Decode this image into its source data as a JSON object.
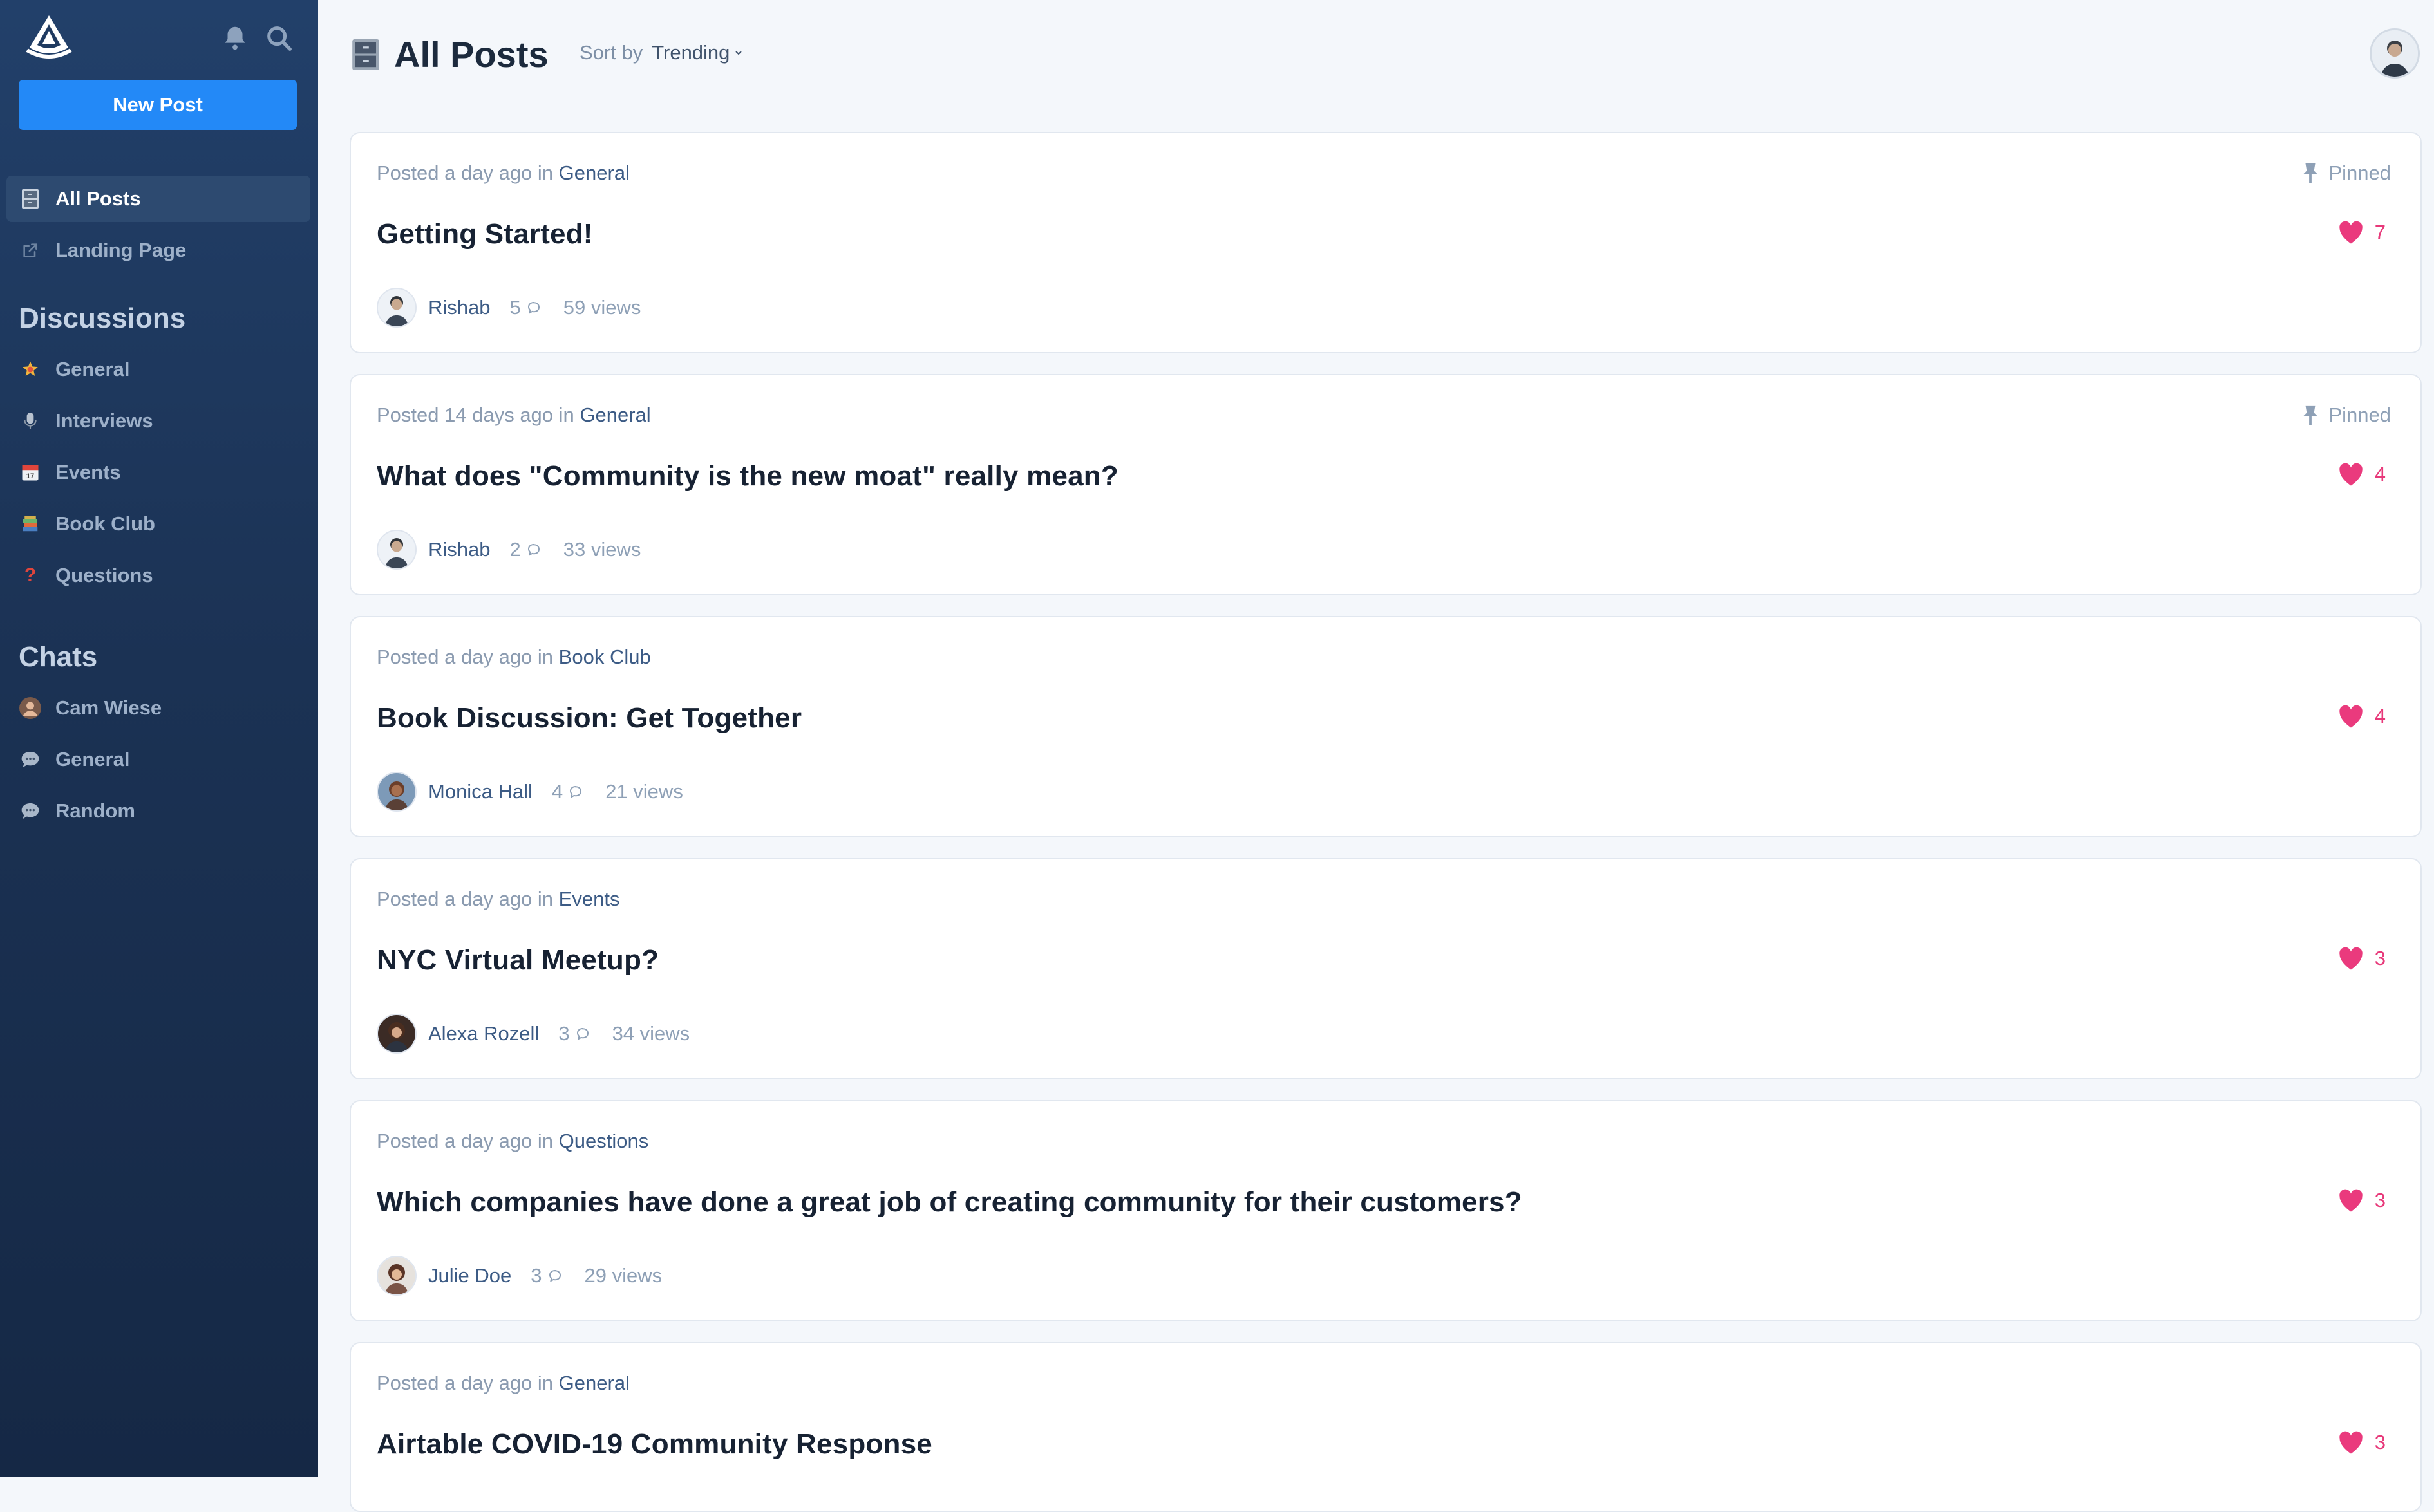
{
  "sidebar": {
    "new_post_label": "New Post",
    "nav": [
      {
        "label": "All Posts",
        "icon": "file-cabinet-icon",
        "active": true
      },
      {
        "label": "Landing Page",
        "icon": "external-link-icon",
        "active": false
      }
    ],
    "discussions_heading": "Discussions",
    "discussions": [
      {
        "label": "General",
        "icon": "star-emoji-icon"
      },
      {
        "label": "Interviews",
        "icon": "microphone-emoji-icon"
      },
      {
        "label": "Events",
        "icon": "calendar-emoji-icon"
      },
      {
        "label": "Book Club",
        "icon": "books-emoji-icon"
      },
      {
        "label": "Questions",
        "icon": "question-mark-emoji-icon"
      }
    ],
    "chats_heading": "Chats",
    "chats": [
      {
        "label": "Cam Wiese",
        "icon": "avatar"
      },
      {
        "label": "General",
        "icon": "speech-bubble-emoji-icon"
      },
      {
        "label": "Random",
        "icon": "speech-bubble-emoji-icon"
      }
    ]
  },
  "header": {
    "title": "All Posts",
    "sort_label": "Sort by",
    "sort_value": "Trending"
  },
  "posts": [
    {
      "posted": "Posted a day ago in",
      "category": "General",
      "pinned": "Pinned",
      "title": "Getting Started!",
      "likes": "7",
      "author": "Rishab",
      "comments": "5",
      "views": "59 views"
    },
    {
      "posted": "Posted 14 days ago in",
      "category": "General",
      "pinned": "Pinned",
      "title": "What does \"Community is the new moat\" really mean?",
      "likes": "4",
      "author": "Rishab",
      "comments": "2",
      "views": "33 views"
    },
    {
      "posted": "Posted a day ago in",
      "category": "Book Club",
      "title": "Book Discussion: Get Together",
      "likes": "4",
      "author": "Monica Hall",
      "comments": "4",
      "views": "21 views"
    },
    {
      "posted": "Posted a day ago in",
      "category": "Events",
      "title": "NYC Virtual Meetup?",
      "likes": "3",
      "author": "Alexa Rozell",
      "comments": "3",
      "views": "34 views"
    },
    {
      "posted": "Posted a day ago in",
      "category": "Questions",
      "title": "Which companies have done a great job of creating community for their customers?",
      "likes": "3",
      "author": "Julie Doe",
      "comments": "3",
      "views": "29 views"
    },
    {
      "posted": "Posted a day ago in",
      "category": "General",
      "title": "Airtable COVID-19 Community Response",
      "likes": "3"
    }
  ],
  "colors": {
    "sidebar": "#1b3254",
    "accent": "#2389f7",
    "heart": "#e8397a"
  }
}
